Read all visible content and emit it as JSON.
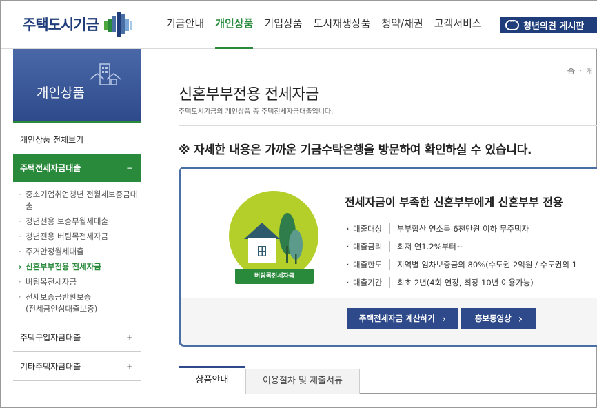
{
  "header": {
    "logo_text": "주택도시기금",
    "nav": [
      {
        "label": "기금안내",
        "active": false
      },
      {
        "label": "개인상품",
        "active": true
      },
      {
        "label": "기업상품",
        "active": false
      },
      {
        "label": "도시재생상품",
        "active": false
      },
      {
        "label": "청약/채권",
        "active": false
      },
      {
        "label": "고객서비스",
        "active": false
      }
    ],
    "board_button": "청년의견 게시판"
  },
  "sidebar": {
    "banner_title": "개인상품",
    "all_link": "개인상품 전체보기",
    "open_category": {
      "label": "주택전세자금대출",
      "toggle": "−"
    },
    "sub_items": [
      {
        "label": "중소기업취업청년 전월세보증금대출",
        "active": false
      },
      {
        "label": "청년전용 보증부월세대출",
        "active": false
      },
      {
        "label": "청년전용 버팀목전세자금",
        "active": false
      },
      {
        "label": "주거안정월세대출",
        "active": false
      },
      {
        "label": "신혼부부전용 전세자금",
        "active": true
      },
      {
        "label": "버팀목전세자금",
        "active": false
      },
      {
        "label": "전세보증금반환보증\n(전세금안심대출보증)",
        "active": false
      }
    ],
    "categories": [
      {
        "label": "주택구입자금대출",
        "toggle": "+"
      },
      {
        "label": "기타주택자금대출",
        "toggle": "+"
      }
    ]
  },
  "breadcrumb": {
    "item": "개"
  },
  "main": {
    "title": "신혼부부전용 전세자금",
    "description": "주택도시기금의 개인상품 중 주택전세자금대출입니다.",
    "notice": "※ 자세한 내용은 가까운 기금수탁은행을 방문하여 확인하실 수 있습니다.",
    "product": {
      "badge": "버팀목전세자금",
      "headline": "전세자금이 부족한 신혼부부에게 신혼부부 전용",
      "specs": [
        {
          "key": "대출대상",
          "value": "부부합산 연소득 6천만원 이하 무주택자"
        },
        {
          "key": "대출금리",
          "value": "최저 연1.2%부터~"
        },
        {
          "key": "대출한도",
          "value": "지역별 임차보증금의 80%(수도권 2억원 / 수도권외 1"
        },
        {
          "key": "대출기간",
          "value": "최초 2년(4회 연장, 최장 10년 이용가능)"
        }
      ],
      "buttons": {
        "calc": "주택전세자금 계산하기",
        "video": "홍보동영상"
      }
    },
    "tabs": [
      {
        "label": "상품안내",
        "active": true
      },
      {
        "label": "이용절차 및 제출서류",
        "active": false
      }
    ]
  },
  "colors": {
    "navy": "#2e4a8a",
    "green": "#2a8a3c",
    "lime": "#b4ce2a"
  }
}
